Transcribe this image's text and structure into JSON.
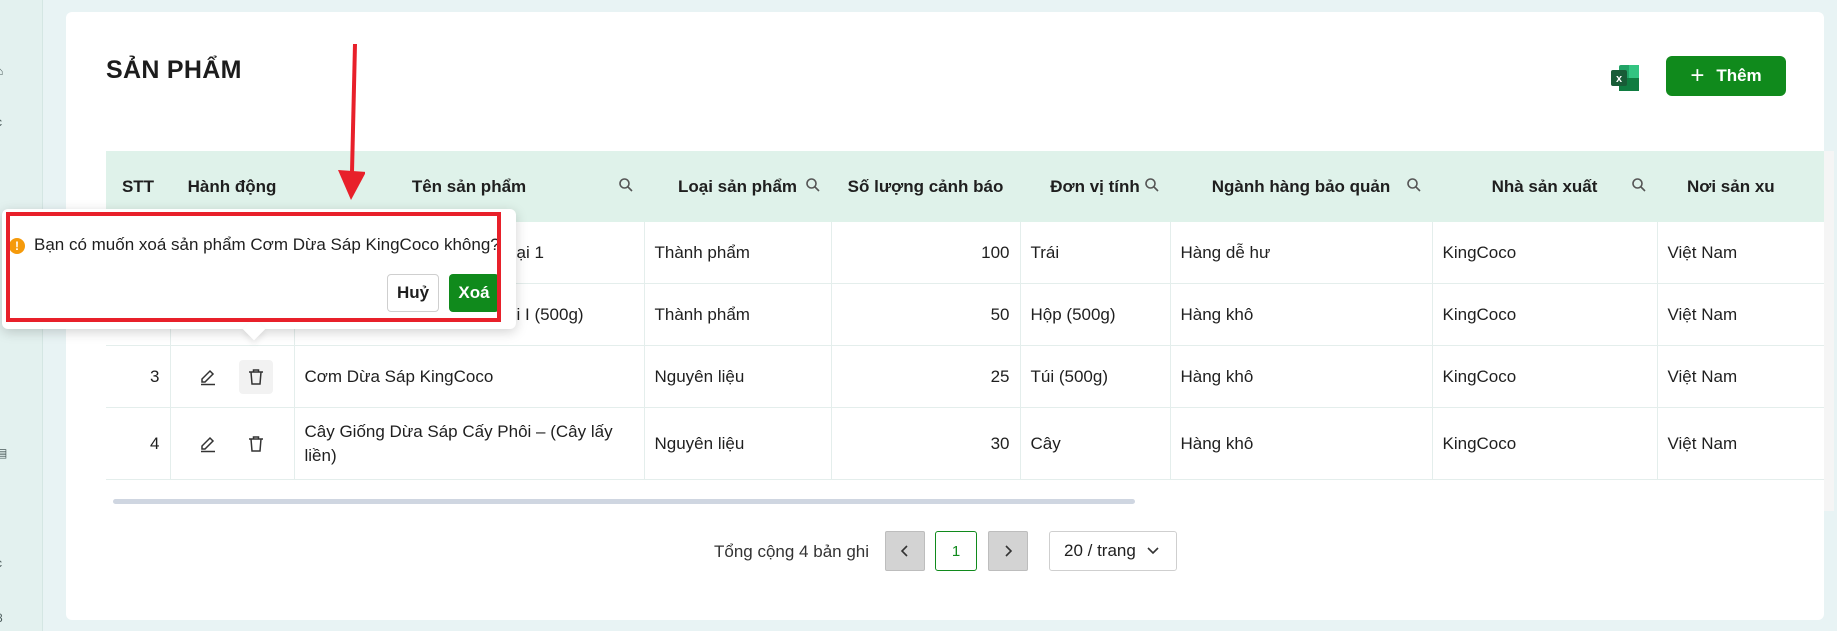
{
  "page": {
    "title": "SẢN PHẨM",
    "add_label": "Thêm"
  },
  "colors": {
    "primary": "#108a1c",
    "header_bg": "#dff2ea",
    "annotation": "#e8202a",
    "warning": "#f59a0b"
  },
  "table": {
    "columns": [
      "STT",
      "Hành động",
      "Tên sản phẩm",
      "Loại sản phẩm",
      "Số lượng cảnh báo",
      "Đơn vị tính",
      "Ngành hàng bảo quản",
      "Nhà sản xuất",
      "Nơi sản xu"
    ],
    "rows": [
      {
        "stt": "",
        "name": "ại 1",
        "type": "Thành phẩm",
        "qty": "100",
        "unit": "Trái",
        "category": "Hàng dễ hư",
        "maker": "KingCoco",
        "origin": "Việt Nam"
      },
      {
        "stt": "",
        "name": "i I (500g)",
        "type": "Thành phẩm",
        "qty": "50",
        "unit": "Hộp (500g)",
        "category": "Hàng khô",
        "maker": "KingCoco",
        "origin": "Việt Nam"
      },
      {
        "stt": "3",
        "name": "Cơm Dừa Sáp KingCoco",
        "type": "Nguyên liệu",
        "qty": "25",
        "unit": "Túi (500g)",
        "category": "Hàng khô",
        "maker": "KingCoco",
        "origin": "Việt Nam"
      },
      {
        "stt": "4",
        "name": "Cây Giống Dừa Sáp Cấy Phôi – (Cây lấy liền)",
        "type": "Nguyên liệu",
        "qty": "30",
        "unit": "Cây",
        "category": "Hàng khô",
        "maker": "KingCoco",
        "origin": "Việt Nam"
      }
    ]
  },
  "pagination": {
    "total_text": "Tổng cộng 4 bản ghi",
    "current_page": "1",
    "page_size": "20 / trang"
  },
  "popconfirm": {
    "message": "Bạn có muốn xoá sản phẩm Cơm Dừa Sáp KingCoco không?",
    "cancel_label": "Huỷ",
    "ok_label": "Xoá"
  }
}
